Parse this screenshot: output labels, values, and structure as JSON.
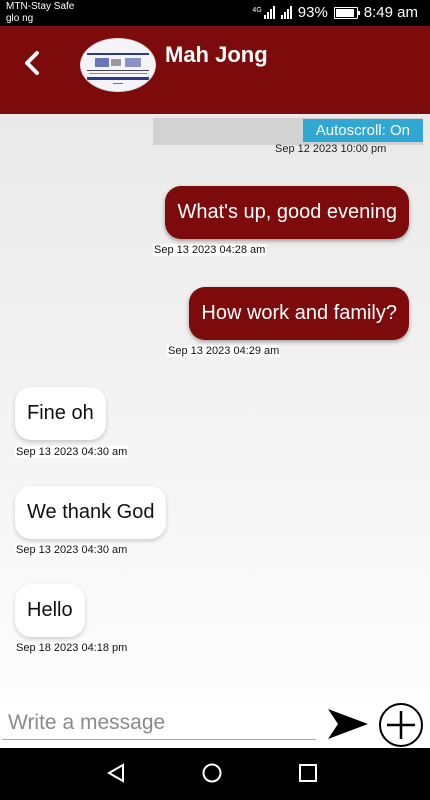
{
  "status_bar": {
    "carrier_line1": "MTN-Stay Safe",
    "carrier_line2": "glo ng",
    "network_label": "4G",
    "battery": "93%",
    "battery_level": 0.93,
    "time": "8:49 am"
  },
  "header": {
    "title": "Mah Jong",
    "back_icon": "back-arrow-icon",
    "avatar_icon": "contact-avatar"
  },
  "chat": {
    "autoscroll_label": "Autoscroll: On",
    "partial_timestamp": "Sep 12 2023 10:00 pm",
    "messages": [
      {
        "direction": "sent",
        "text": "What's up, good evening",
        "time": "Sep 13 2023 04:28 am"
      },
      {
        "direction": "sent",
        "text": "How work and family?",
        "time": "Sep 13 2023 04:29 am"
      },
      {
        "direction": "received",
        "text": "Fine oh",
        "time": "Sep 13 2023 04:30 am"
      },
      {
        "direction": "received",
        "text": "We thank God",
        "time": "Sep 13 2023 04:30 am"
      },
      {
        "direction": "received",
        "text": "Hello",
        "time": "Sep 18 2023 04:18 pm"
      }
    ]
  },
  "composer": {
    "placeholder": "Write a message",
    "value": "",
    "send_icon": "send-icon",
    "add_icon": "add-circle-icon"
  },
  "nav_bar": {
    "back_icon": "nav-back-icon",
    "home_icon": "nav-home-icon",
    "recents_icon": "nav-recents-icon"
  },
  "colors": {
    "primary": "#7e0b0b",
    "accent": "#31a8d3",
    "bubble_received": "#ffffff"
  }
}
